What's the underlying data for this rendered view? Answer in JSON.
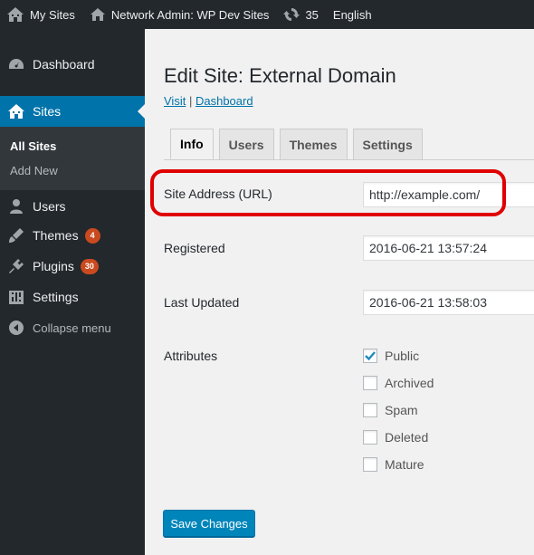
{
  "adminbar": {
    "my_sites": "My Sites",
    "network_admin": "Network Admin: WP Dev Sites",
    "updates_count": "35",
    "language": "English"
  },
  "sidebar": {
    "dashboard": "Dashboard",
    "sites": "Sites",
    "all_sites": "All Sites",
    "add_new": "Add New",
    "users": "Users",
    "themes": "Themes",
    "themes_badge": "4",
    "plugins": "Plugins",
    "plugins_badge": "30",
    "settings": "Settings",
    "collapse": "Collapse menu"
  },
  "page": {
    "title": "Edit Site: External Domain",
    "visit_link": "Visit",
    "separator": "|",
    "dashboard_link": "Dashboard"
  },
  "tabs": [
    "Info",
    "Users",
    "Themes",
    "Settings"
  ],
  "form": {
    "site_address_label": "Site Address (URL)",
    "site_address_value": "http://example.com/",
    "registered_label": "Registered",
    "registered_value": "2016-06-21 13:57:24",
    "last_updated_label": "Last Updated",
    "last_updated_value": "2016-06-21 13:58:03",
    "attributes_label": "Attributes",
    "attributes": [
      {
        "label": "Public",
        "checked": true
      },
      {
        "label": "Archived",
        "checked": false
      },
      {
        "label": "Spam",
        "checked": false
      },
      {
        "label": "Deleted",
        "checked": false
      },
      {
        "label": "Mature",
        "checked": false
      }
    ],
    "save_label": "Save Changes"
  },
  "colors": {
    "adminbar_bg": "#23282d",
    "current_menu": "#0073aa",
    "button": "#0085ba",
    "badge": "#ca4a1f",
    "highlight": "#e00000"
  }
}
